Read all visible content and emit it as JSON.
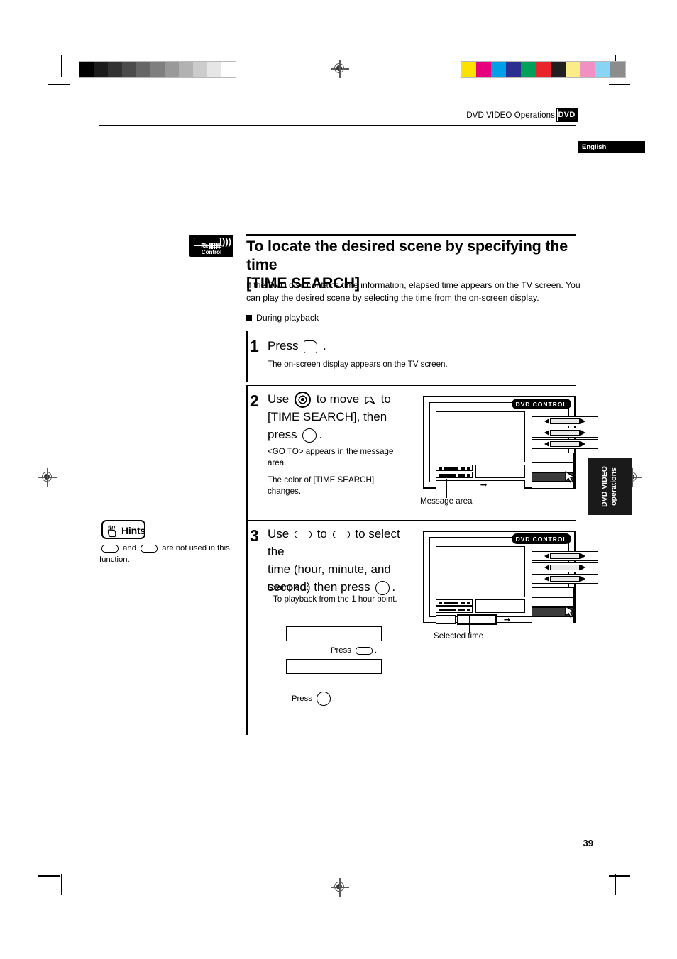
{
  "page": {
    "number": "39",
    "language_badge": "English",
    "header_title": "DVD VIDEO Operations",
    "header_badge": "DVD",
    "side_tab": "DVD VIDEO\noperations",
    "side_tab_line1": "DVD VIDEO",
    "side_tab_line2": "operations"
  },
  "calibration": {
    "grayscale": [
      "#000000",
      "#1c1c1c",
      "#333333",
      "#4c4c4c",
      "#666666",
      "#7f7f7f",
      "#999999",
      "#b2b2b2",
      "#cccccc",
      "#e6e6e6",
      "#ffffff"
    ],
    "colorbars": [
      "#ffe100",
      "#e6007e",
      "#00a0e9",
      "#2b2f8f",
      "#00a05a",
      "#e8252a",
      "#231f20",
      "#fbec87",
      "#f390c3",
      "#89d4f3",
      "#8c8c8c"
    ]
  },
  "remote_badge": {
    "label": "Remote Control",
    "icon": "remote-control-icon"
  },
  "section": {
    "title_line1": "To locate the desired scene by specifying the time",
    "title_line2": "[TIME SEARCH]",
    "intro": "If the DVD disc contains time information, elapsed time appears on the TV screen. You can play the desired scene by selecting the time from the on-screen display.",
    "subhead": "During playback"
  },
  "steps": [
    {
      "number": "1",
      "head_before": "Press",
      "head_glyph": "on-screen-display-key",
      "head_after": ".",
      "body": [
        "The on-screen display appears on the TV screen."
      ]
    },
    {
      "number": "2",
      "head_parts": [
        "Use",
        "to move",
        "to",
        "[TIME SEARCH],  then",
        "press",
        "."
      ],
      "head_line2": "[TIME SEARCH],  then",
      "head_line3_before": "press",
      "head_line3_after": ".",
      "body": [
        "<GO TO> appears in the message area.",
        "The color of [TIME SEARCH] changes."
      ]
    },
    {
      "number": "3",
      "head_word_use": "Use",
      "head_word_to1": "to",
      "head_word_to2": "to select the",
      "head_line2": "time (hour, minute, and",
      "head_line3_before": "second) then press",
      "head_line3_after": ".",
      "example_title": "Example 1:",
      "example_text": "To playback from the 1 hour point."
    }
  ],
  "figures": {
    "fig1": {
      "panel_title": "DVD CONTROL",
      "caption": "Message area"
    },
    "fig2": {
      "panel_title": "DVD CONTROL",
      "caption": "Selected time"
    }
  },
  "example_flow": {
    "press_label_1": "Press",
    "press_label_2": "Press",
    "glyph_1": "cursor-pill-key",
    "glyph_2": "enter-key",
    "box_1_value": "",
    "box_2_value": ""
  },
  "hints": {
    "title": "Hints",
    "icon": "pointing-hand-icon",
    "text_before": "and",
    "text_after": "are not used in this function."
  }
}
